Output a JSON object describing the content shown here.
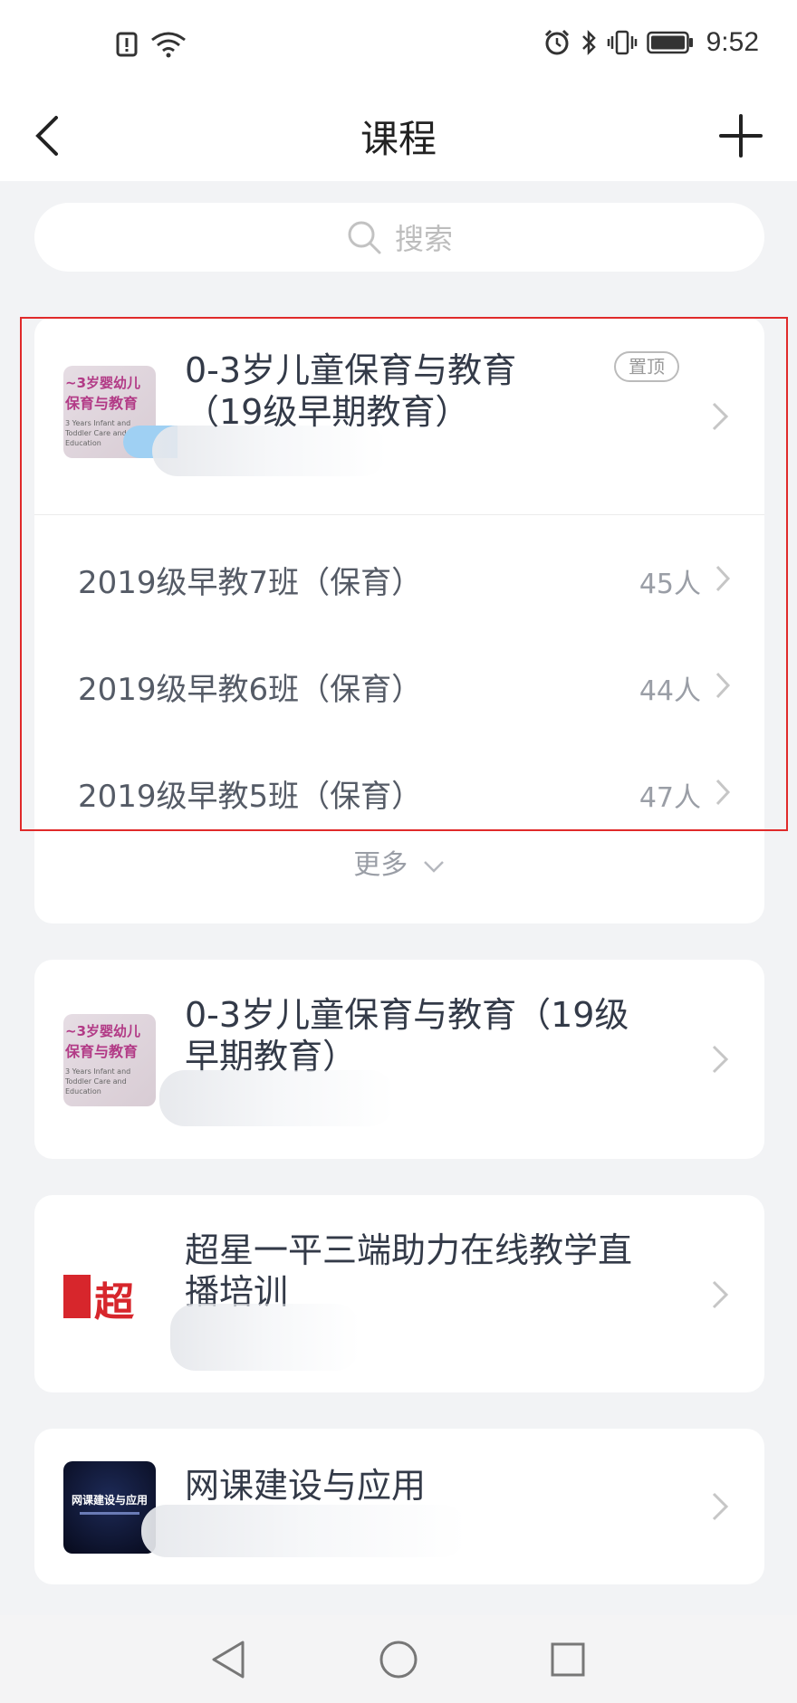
{
  "status_bar": {
    "time": "9:52",
    "left_icons": [
      "alert-icon",
      "wifi-icon"
    ],
    "right_icons": [
      "alarm-icon",
      "bluetooth-icon",
      "vibrate-icon",
      "battery-icon"
    ]
  },
  "header": {
    "title": "课程",
    "back_icon": "chevron-left-icon",
    "add_icon": "plus-icon"
  },
  "search": {
    "placeholder": "搜索"
  },
  "courses": [
    {
      "title": "0-3岁儿童保育与教育\n（19级早期教育）",
      "pinned_badge": "置顶",
      "thumbnail": {
        "line1": "~3岁婴幼儿",
        "line2": "保育与教育",
        "line3": "3 Years Infant and Toddler Care and Education"
      },
      "classes": [
        {
          "name": "2019级早教7班（保育）",
          "count": "45人"
        },
        {
          "name": "2019级早教6班（保育）",
          "count": "44人"
        },
        {
          "name": "2019级早教5班（保育）",
          "count": "47人"
        }
      ],
      "more_label": "更多"
    },
    {
      "title": "0-3岁儿童保育与教育（19级\n早期教育）",
      "thumbnail": {
        "line1": "~3岁婴幼儿",
        "line2": "保育与教育",
        "line3": "3 Years Infant and Toddler Care and Education"
      }
    },
    {
      "title": "超星一平三端助力在线教学直\n播培训",
      "thumbnail": {
        "word": "超"
      }
    },
    {
      "title": "网课建设与应用",
      "thumbnail": {
        "text": "网课建设与应用"
      }
    }
  ],
  "colors": {
    "background": "#f2f3f5",
    "card": "#ffffff",
    "highlight_border": "#e02a2a",
    "title_text": "#333a48",
    "muted_text": "#9a9ea6"
  },
  "system_nav": {
    "buttons": [
      "back-triangle-icon",
      "home-circle-icon",
      "recents-square-icon"
    ]
  }
}
